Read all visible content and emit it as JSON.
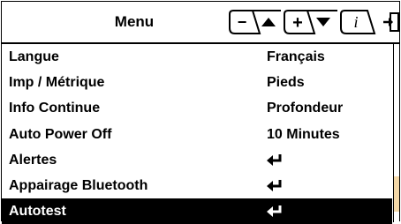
{
  "header": {
    "title": "Menu",
    "buttons": [
      {
        "name": "minus-up",
        "symbol": "−"
      },
      {
        "name": "plus-down",
        "symbol": "+"
      },
      {
        "name": "info",
        "symbol": "i"
      }
    ]
  },
  "menu": {
    "items": [
      {
        "label": "Langue",
        "value": "Français"
      },
      {
        "label": "Imp / Métrique",
        "value": "Pieds"
      },
      {
        "label": "Info Continue",
        "value": "Profondeur"
      },
      {
        "label": "Auto Power Off",
        "value": "10 Minutes"
      },
      {
        "label": "Alertes",
        "value": ""
      },
      {
        "label": "Appairage Bluetooth",
        "value": ""
      },
      {
        "label": "Autotest",
        "value": ""
      }
    ],
    "selected_index": 6
  },
  "colors": {
    "accent_scroll": "#f4d8a8",
    "selected_bg": "#000000"
  },
  "icons": {
    "enter": "enter-arrow-icon",
    "exit": "exit-door-icon"
  }
}
